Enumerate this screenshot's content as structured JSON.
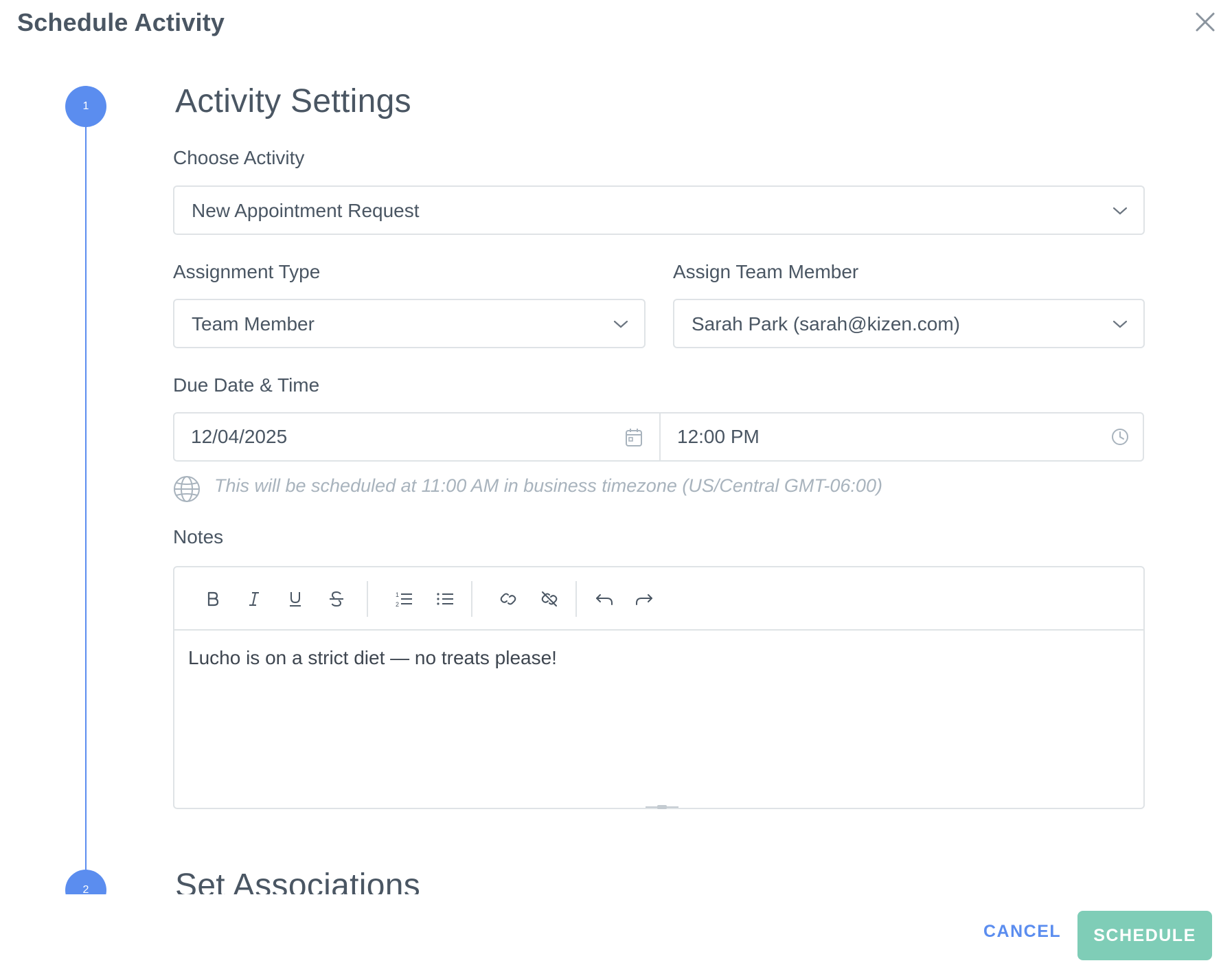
{
  "header": {
    "title": "Schedule Activity"
  },
  "steps": [
    {
      "number": "1",
      "title": "Activity Settings"
    },
    {
      "number": "2",
      "title": "Set Associations"
    }
  ],
  "form": {
    "choose_activity": {
      "label": "Choose Activity",
      "value": "New Appointment Request"
    },
    "assignment_type": {
      "label": "Assignment Type",
      "value": "Team Member"
    },
    "assign_team_member": {
      "label": "Assign Team Member",
      "value": "Sarah Park (sarah@kizen.com)"
    },
    "due": {
      "label": "Due Date & Time",
      "date": "12/04/2025",
      "time": "12:00 PM",
      "timezone_note": "This will be scheduled at 11:00 AM in business timezone (US/Central GMT-06:00)"
    },
    "notes": {
      "label": "Notes",
      "text": "Lucho is on a strict diet — no treats please!",
      "toolbar": [
        "bold-icon",
        "italic-icon",
        "underline-icon",
        "strikethrough-icon",
        "ordered-list-icon",
        "bullet-list-icon",
        "link-icon",
        "unlink-icon",
        "undo-icon",
        "redo-icon"
      ]
    }
  },
  "footer": {
    "cancel_label": "CANCEL",
    "schedule_label": "SCHEDULE"
  },
  "colors": {
    "accent": "#5b8def",
    "primary_button": "#7fcdb7",
    "border": "#dfe3e6",
    "muted_text": "#a8b3bd"
  }
}
